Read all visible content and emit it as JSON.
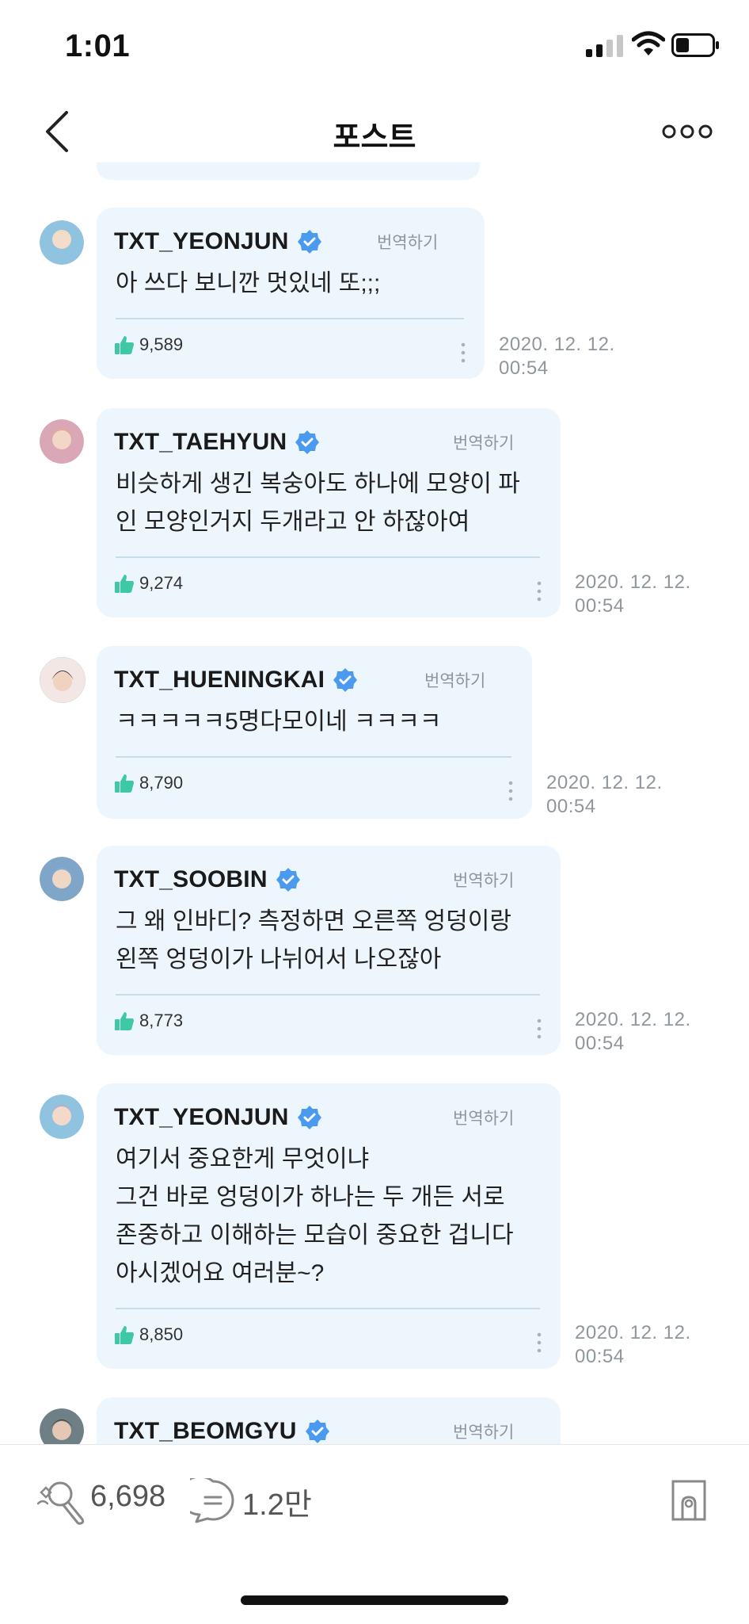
{
  "status_bar": {
    "time": "1:01"
  },
  "nav": {
    "title": "포스트"
  },
  "translate_label": "번역하기",
  "comments": [
    {
      "username": "TXT_YEONJUN",
      "text": "아 쓰다 보니깐 멋있네 또;;;",
      "likes": "9,589",
      "date": "2020. 12. 12.",
      "time": "00:54",
      "avatar_color": "#8fc3df"
    },
    {
      "username": "TXT_TAEHYUN",
      "text": "비슷하게 생긴 복숭아도 하나에 모양이 파\n인 모양인거지 두개라고 안 하잖아여",
      "likes": "9,274",
      "date": "2020. 12. 12.",
      "time": "00:54",
      "avatar_color": "#d9a7b6"
    },
    {
      "username": "TXT_HUENINGKAI",
      "text": "ㅋㅋㅋㅋㅋ5명다모이네 ㅋㅋㅋㅋ",
      "likes": "8,790",
      "date": "2020. 12. 12.",
      "time": "00:54",
      "avatar_color": "#f2e7e4"
    },
    {
      "username": "TXT_SOOBIN",
      "text": "그 왜 인바디? 측정하면 오른쪽 엉덩이랑\n왼쪽 엉덩이가 나뉘어서 나오잖아",
      "likes": "8,773",
      "date": "2020. 12. 12.",
      "time": "00:54",
      "avatar_color": "#7fa6c9"
    },
    {
      "username": "TXT_YEONJUN",
      "text": "여기서 중요한게 무엇이냐\n그건 바로 엉덩이가 하나는 두 개든 서로\n존중하고 이해하는 모습이 중요한 겁니다\n아시겠어요 여러분~?",
      "likes": "8,850",
      "date": "2020. 12. 12.",
      "time": "00:54",
      "avatar_color": "#e9a9ae"
    },
    {
      "username": "TXT_BEOMGYU",
      "avatar_color": "#6f7f86"
    }
  ],
  "bottom_bar": {
    "reaction_count": "6,698",
    "comment_count": "1.2만"
  },
  "colors": {
    "bubble": "#eef6fd",
    "verified": "#4a9bef",
    "like_icon": "#3ec9a4"
  }
}
